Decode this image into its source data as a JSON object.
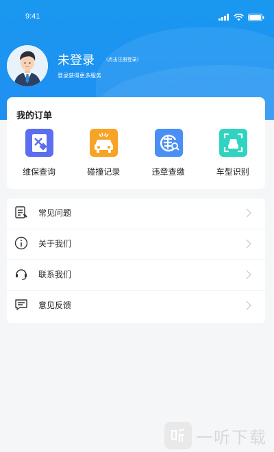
{
  "status": {
    "time": "9:41"
  },
  "profile": {
    "title": "未登录",
    "hint": "(点击注册登录)",
    "subtitle": "登录获得更多服务"
  },
  "orders": {
    "heading": "我的订单",
    "items": [
      {
        "label": "维保查询",
        "icon": "maintenance-icon",
        "color": "#5b6ef0"
      },
      {
        "label": "碰撞记录",
        "icon": "car-crash-icon",
        "color": "#f7a325"
      },
      {
        "label": "违章查缴",
        "icon": "violation-icon",
        "color": "#4a8ff5"
      },
      {
        "label": "车型识别",
        "icon": "car-scan-icon",
        "color": "#2fd3c0"
      }
    ]
  },
  "menu": {
    "items": [
      {
        "label": "常见问题",
        "icon": "faq-icon"
      },
      {
        "label": "关于我们",
        "icon": "info-icon"
      },
      {
        "label": "联系我们",
        "icon": "headset-icon"
      },
      {
        "label": "意见反馈",
        "icon": "feedback-icon"
      }
    ]
  },
  "watermark": {
    "text": "一听下载"
  },
  "colors": {
    "header": "#1a98f0",
    "background": "#f5f6f8"
  }
}
